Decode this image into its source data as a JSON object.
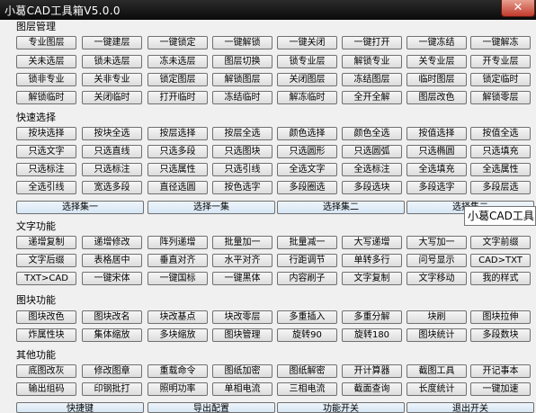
{
  "window": {
    "title": "小葛CAD工具箱V5.0.0",
    "close_label": "✕"
  },
  "sections": [
    {
      "title": "图层管理",
      "rows": [
        [
          "专业图层",
          "一键建层",
          "一键锁定",
          "一键解锁",
          "一键关闭",
          "一键打开",
          "一键冻结",
          "一键解冻"
        ],
        [
          "关未选层",
          "锁未选层",
          "冻未选层",
          "图层切换",
          "锁专业层",
          "解锁专业",
          "关专业层",
          "开专业层"
        ],
        [
          "锁非专业",
          "关非专业",
          "锁定图层",
          "解锁图层",
          "关闭图层",
          "冻结图层",
          "临时图层",
          "锁定临时"
        ],
        [
          "解锁临时",
          "关闭临时",
          "打开临时",
          "冻结临时",
          "解冻临时",
          "全开全解",
          "图层改色",
          "解锁零层"
        ]
      ]
    },
    {
      "title": "快速选择",
      "rows": [
        [
          "按块选择",
          "按块全选",
          "按层选择",
          "按层全选",
          "颜色选择",
          "颜色全选",
          "按值选择",
          "按值全选"
        ],
        [
          "只选文字",
          "只选直线",
          "只选多段",
          "只选图块",
          "只选圆形",
          "只选圆弧",
          "只选椭圆",
          "只选填充"
        ],
        [
          "只选标注",
          "只选标注",
          "只选属性",
          "只选引线",
          "全选文字",
          "全选标注",
          "全选填充",
          "全选属性"
        ],
        [
          "全选引线",
          "宽选多段",
          "直径选圆",
          "按色选字",
          "多段圈选",
          "多段选块",
          "多段选字",
          "多段层选"
        ]
      ],
      "wide": [
        "选择集一",
        "选择一集",
        "选择集二",
        "选择集二"
      ]
    },
    {
      "title": "文字功能",
      "rows": [
        [
          "递增复制",
          "递增修改",
          "阵列递增",
          "批量加一",
          "批量减一",
          "大写递增",
          "大写加一",
          "文字前缀"
        ],
        [
          "文字后缀",
          "表格居中",
          "垂直对齐",
          "水平对齐",
          "行距调节",
          "单转多行",
          "问号显示",
          "CAD>TXT"
        ],
        [
          "TXT>CAD",
          "一键宋体",
          "一键国标",
          "一键黑体",
          "内容刷子",
          "文字复制",
          "文字移动",
          "我的样式"
        ]
      ]
    },
    {
      "title": "图块功能",
      "rows": [
        [
          "图块改色",
          "图块改名",
          "块改基点",
          "块改零层",
          "多重插入",
          "多重分解",
          "块刷",
          "图块拉伸"
        ],
        [
          "炸属性块",
          "集体缩放",
          "多块缩放",
          "图块管理",
          "旋转90",
          "旋转180",
          "图块统计",
          "多段数块"
        ]
      ]
    },
    {
      "title": "其他功能",
      "rows": [
        [
          "底图改灰",
          "修改图章",
          "重载命令",
          "图纸加密",
          "图纸解密",
          "开计算器",
          "截图工具",
          "开记事本"
        ],
        [
          "输出组码",
          "印钢批打",
          "照明功率",
          "单相电流",
          "三相电流",
          "截面查询",
          "长度统计",
          "一键加速"
        ]
      ]
    }
  ],
  "bottom_bar": [
    "快捷键",
    "导出配置",
    "功能开关",
    "退出开关"
  ],
  "tooltip": "小葛CAD工具"
}
